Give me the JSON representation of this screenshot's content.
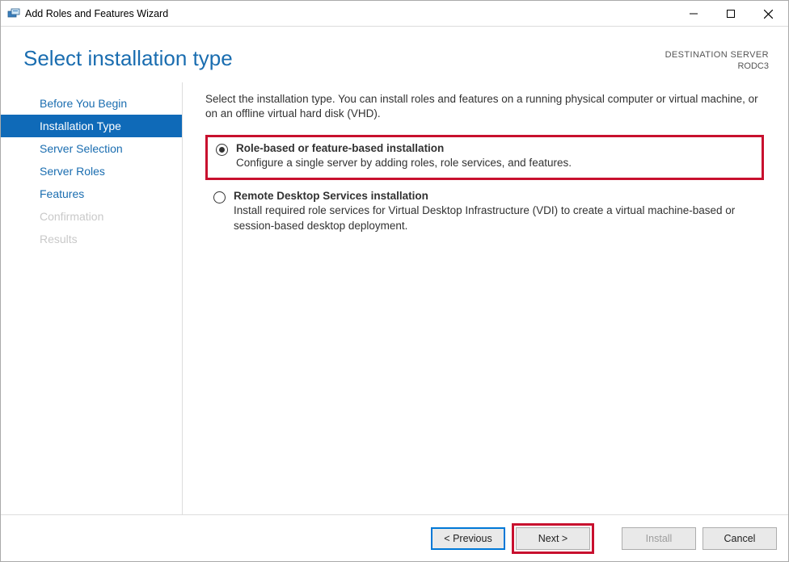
{
  "titlebar": {
    "title": "Add Roles and Features Wizard"
  },
  "destination": {
    "label": "DESTINATION SERVER",
    "value": "RODC3"
  },
  "heading": "Select installation type",
  "sidebar": {
    "items": [
      {
        "label": "Before You Begin",
        "state": "normal"
      },
      {
        "label": "Installation Type",
        "state": "active"
      },
      {
        "label": "Server Selection",
        "state": "normal"
      },
      {
        "label": "Server Roles",
        "state": "normal"
      },
      {
        "label": "Features",
        "state": "normal"
      },
      {
        "label": "Confirmation",
        "state": "disabled"
      },
      {
        "label": "Results",
        "state": "disabled"
      }
    ]
  },
  "main": {
    "intro": "Select the installation type. You can install roles and features on a running physical computer or virtual machine, or on an offline virtual hard disk (VHD).",
    "options": [
      {
        "label": "Role-based or feature-based installation",
        "desc": "Configure a single server by adding roles, role services, and features.",
        "selected": true,
        "highlighted": true
      },
      {
        "label": "Remote Desktop Services installation",
        "desc": "Install required role services for Virtual Desktop Infrastructure (VDI) to create a virtual machine-based or session-based desktop deployment.",
        "selected": false,
        "highlighted": false
      }
    ]
  },
  "footer": {
    "previous": "< Previous",
    "next": "Next >",
    "install": "Install",
    "cancel": "Cancel"
  }
}
